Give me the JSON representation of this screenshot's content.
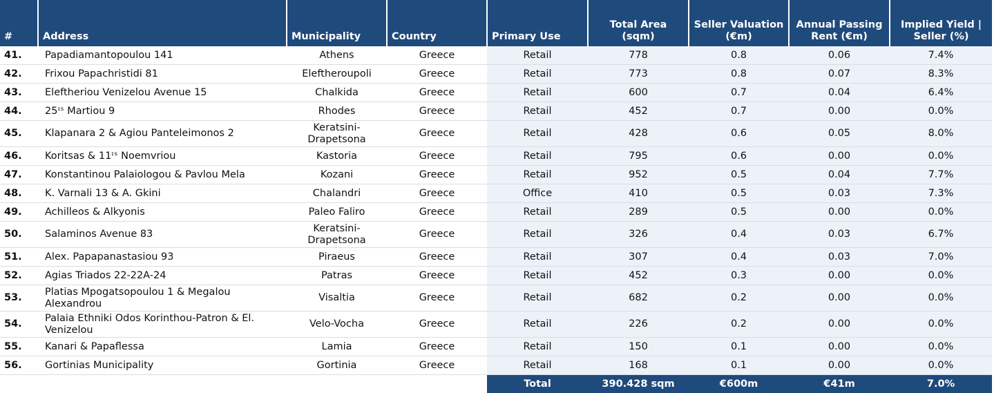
{
  "headers": {
    "num": "#",
    "address": "Address",
    "municipality": "Municipality",
    "country": "Country",
    "use": "Primary Use",
    "area": "Total Area (sqm)",
    "valuation": "Seller Valuation (€m)",
    "rent": "Annual Passing Rent (€m)",
    "yield": "Implied Yield | Seller (%)"
  },
  "rows": [
    {
      "num": "41.",
      "address": "Papadiamantopoulou 141",
      "municipality": "Athens",
      "country": "Greece",
      "use": "Retail",
      "area": "778",
      "valuation": "0.8",
      "rent": "0.06",
      "yield": "7.4%"
    },
    {
      "num": "42.",
      "address": "Frixou Papachristidi 81",
      "municipality": "Eleftheroupoli",
      "country": "Greece",
      "use": "Retail",
      "area": "773",
      "valuation": "0.8",
      "rent": "0.07",
      "yield": "8.3%"
    },
    {
      "num": "43.",
      "address": "Eleftheriou Venizelou Avenue 15",
      "municipality": "Chalkida",
      "country": "Greece",
      "use": "Retail",
      "area": "600",
      "valuation": "0.7",
      "rent": "0.04",
      "yield": "6.4%"
    },
    {
      "num": "44.",
      "address": "25ᶦˢ Martiou 9",
      "municipality": "Rhodes",
      "country": "Greece",
      "use": "Retail",
      "area": "452",
      "valuation": "0.7",
      "rent": "0.00",
      "yield": "0.0%"
    },
    {
      "num": "45.",
      "address": "Klapanara 2 & Agiou Panteleimonos 2",
      "municipality": "Keratsini-Drapetsona",
      "country": "Greece",
      "use": "Retail",
      "area": "428",
      "valuation": "0.6",
      "rent": "0.05",
      "yield": "8.0%",
      "tall": true
    },
    {
      "num": "46.",
      "address": "Koritsas & 11ᶦˢ Noemvriou",
      "municipality": "Kastoria",
      "country": "Greece",
      "use": "Retail",
      "area": "795",
      "valuation": "0.6",
      "rent": "0.00",
      "yield": "0.0%"
    },
    {
      "num": "47.",
      "address": "Konstantinou Palaiologou & Pavlou Mela",
      "municipality": "Kozani",
      "country": "Greece",
      "use": "Retail",
      "area": "952",
      "valuation": "0.5",
      "rent": "0.04",
      "yield": "7.7%"
    },
    {
      "num": "48.",
      "address": "K. Varnali 13 & A. Gkini",
      "municipality": "Chalandri",
      "country": "Greece",
      "use": "Office",
      "area": "410",
      "valuation": "0.5",
      "rent": "0.03",
      "yield": "7.3%"
    },
    {
      "num": "49.",
      "address": "Achilleos & Alkyonis",
      "municipality": "Paleo Faliro",
      "country": "Greece",
      "use": "Retail",
      "area": "289",
      "valuation": "0.5",
      "rent": "0.00",
      "yield": "0.0%"
    },
    {
      "num": "50.",
      "address": "Salaminos Avenue 83",
      "municipality": "Keratsini-Drapetsona",
      "country": "Greece",
      "use": "Retail",
      "area": "326",
      "valuation": "0.4",
      "rent": "0.03",
      "yield": "6.7%",
      "tall": true
    },
    {
      "num": "51.",
      "address": "Alex. Papapanastasiou 93",
      "municipality": "Piraeus",
      "country": "Greece",
      "use": "Retail",
      "area": "307",
      "valuation": "0.4",
      "rent": "0.03",
      "yield": "7.0%"
    },
    {
      "num": "52.",
      "address": "Agias Triados 22-22A-24",
      "municipality": "Patras",
      "country": "Greece",
      "use": "Retail",
      "area": "452",
      "valuation": "0.3",
      "rent": "0.00",
      "yield": "0.0%"
    },
    {
      "num": "53.",
      "address": "Platias Mpogatsopoulou 1 & Megalou Alexandrou",
      "municipality": "Visaltia",
      "country": "Greece",
      "use": "Retail",
      "area": "682",
      "valuation": "0.2",
      "rent": "0.00",
      "yield": "0.0%",
      "tall": true
    },
    {
      "num": "54.",
      "address": "Palaia Ethniki Odos Korinthou-Patron & El. Venizelou",
      "municipality": "Velo-Vocha",
      "country": "Greece",
      "use": "Retail",
      "area": "226",
      "valuation": "0.2",
      "rent": "0.00",
      "yield": "0.0%",
      "tall": true
    },
    {
      "num": "55.",
      "address": "Kanari & Papaflessa",
      "municipality": "Lamia",
      "country": "Greece",
      "use": "Retail",
      "area": "150",
      "valuation": "0.1",
      "rent": "0.00",
      "yield": "0.0%"
    },
    {
      "num": "56.",
      "address": "Gortinias Municipality",
      "municipality": "Gortinia",
      "country": "Greece",
      "use": "Retail",
      "area": "168",
      "valuation": "0.1",
      "rent": "0.00",
      "yield": "0.0%"
    }
  ],
  "total": {
    "label": "Total",
    "area": "390.428 sqm",
    "valuation": "€600m",
    "rent": "€41m",
    "yield": "7.0%"
  },
  "colors": {
    "header_bg": "#1f4a7c",
    "right_shade": "#edf2f9"
  }
}
